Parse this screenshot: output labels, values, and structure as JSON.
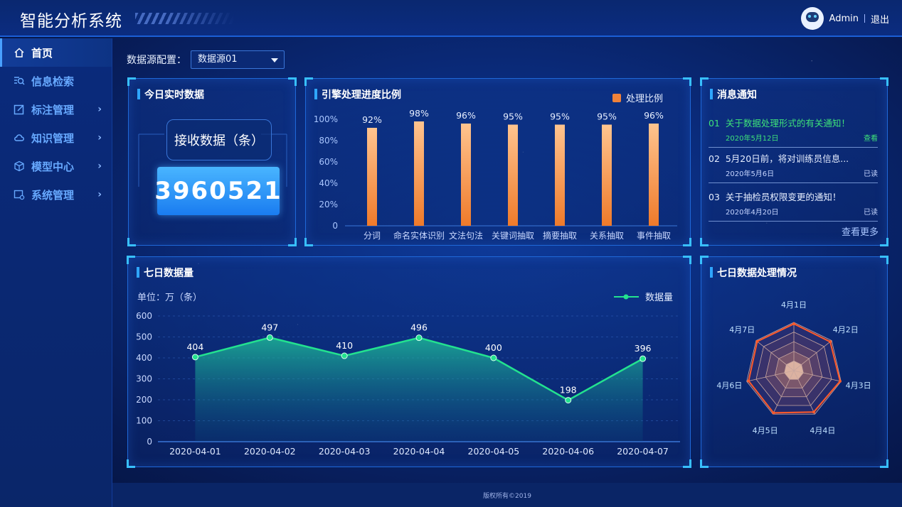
{
  "app": {
    "title": "智能分析系统"
  },
  "user": {
    "name": "Admin",
    "logout": "退出"
  },
  "sidebar": {
    "items": [
      {
        "label": "首页",
        "icon": "home-icon",
        "active": true
      },
      {
        "label": "信息检索",
        "icon": "search-list-icon"
      },
      {
        "label": "标注管理",
        "icon": "edit-icon"
      },
      {
        "label": "知识管理",
        "icon": "knowledge-icon"
      },
      {
        "label": "模型中心",
        "icon": "cube-icon"
      },
      {
        "label": "系统管理",
        "icon": "settings-icon"
      }
    ]
  },
  "source": {
    "label": "数据源配置：",
    "value": "数据源01"
  },
  "realtime": {
    "title": "今日实时数据",
    "label": "接收数据（条）",
    "value": "3960521"
  },
  "progress_chart": {
    "title": "引擎处理进度比例",
    "legend": "处理比例",
    "y_ticks": [
      "0",
      "20%",
      "40%",
      "60%",
      "80%",
      "100%"
    ]
  },
  "messages": {
    "title": "消息通知",
    "items": [
      {
        "num": "01",
        "text": "关于数据处理形式的有关通知！",
        "date": "2020年5月12日",
        "status": "查看"
      },
      {
        "num": "02",
        "text": "5月20日前，将对训练员信息...",
        "date": "2020年5月6日",
        "status": "已读"
      },
      {
        "num": "03",
        "text": "关于抽检员权限变更的通知！",
        "date": "2020年4月20日",
        "status": "已读"
      }
    ],
    "more": "查看更多"
  },
  "line_chart": {
    "title": "七日数据量",
    "unit": "单位：万（条）",
    "legend": "数据量",
    "y_ticks": [
      "0",
      "100",
      "200",
      "300",
      "400",
      "500",
      "600"
    ]
  },
  "radar": {
    "title": "七日数据处理情况",
    "labels": [
      "4月1日",
      "4月2日",
      "4月3日",
      "4月4日",
      "4月5日",
      "4月6日",
      "4月7日"
    ]
  },
  "footer": {
    "text": "版权所有©2019"
  },
  "colors": {
    "accent": "#2fa6ff",
    "bar": "#f0823a",
    "line": "#23e28f",
    "radar": "#ff5a2a",
    "highlight": "#3ee27a"
  },
  "chart_data": [
    {
      "type": "bar",
      "title": "引擎处理进度比例",
      "categories": [
        "分词",
        "命名实体识别",
        "文法句法",
        "关键词抽取",
        "摘要抽取",
        "关系抽取",
        "事件抽取"
      ],
      "series": [
        {
          "name": "处理比例",
          "values": [
            92,
            98,
            96,
            95,
            95,
            95,
            96
          ]
        }
      ],
      "value_labels": [
        "92%",
        "98%",
        "96%",
        "95%",
        "95%",
        "95%",
        "96%"
      ],
      "ylim": [
        0,
        100
      ]
    },
    {
      "type": "line",
      "title": "七日数据量",
      "ylabel": "单位：万（条）",
      "x": [
        "2020-04-01",
        "2020-04-02",
        "2020-04-03",
        "2020-04-04",
        "2020-04-05",
        "2020-04-06",
        "2020-04-07"
      ],
      "series": [
        {
          "name": "数据量",
          "values": [
            404,
            497,
            410,
            496,
            400,
            198,
            396
          ]
        }
      ],
      "ylim": [
        0,
        600
      ]
    },
    {
      "type": "radar",
      "title": "七日数据处理情况",
      "categories": [
        "4月1日",
        "4月2日",
        "4月3日",
        "4月4日",
        "4月5日",
        "4月6日",
        "4月7日"
      ],
      "series": [
        {
          "values": [
            0.97,
            0.96,
            0.98,
            0.95,
            0.97,
            0.96,
            0.97
          ]
        }
      ],
      "rmax": 1
    }
  ]
}
